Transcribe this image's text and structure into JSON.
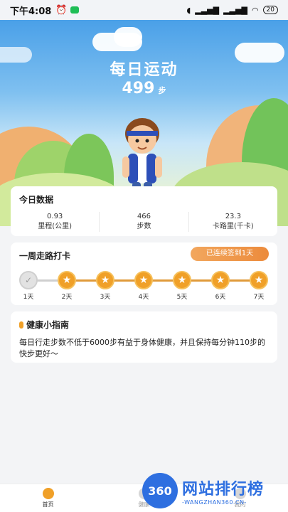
{
  "status_bar": {
    "time": "下午4:08",
    "battery": "20"
  },
  "hero": {
    "title": "每日运动",
    "steps": "499",
    "steps_unit": "步"
  },
  "today": {
    "title": "今日数据",
    "stats": [
      {
        "value": "0.93",
        "label": "里程(公里)"
      },
      {
        "value": "466",
        "label": "步数"
      },
      {
        "value": "23.3",
        "label": "卡路里(千卡)"
      }
    ]
  },
  "checkin": {
    "title": "一周走路打卡",
    "badge": "已连续签到1天",
    "days": [
      "1天",
      "2天",
      "3天",
      "4天",
      "5天",
      "6天",
      "7天"
    ],
    "checked_days": 1
  },
  "guide": {
    "title": "健康小指南",
    "text": "每日行走步数不低于6000步有益于身体健康，并且保持每分钟110步的快步更好～"
  },
  "tabbar": {
    "tabs": [
      {
        "label": "首页"
      },
      {
        "label": "健康"
      },
      {
        "label": "我的"
      }
    ]
  },
  "watermark": {
    "logo": "360",
    "title": "网站排行榜",
    "url": "-WANGZHAN360.CN-"
  },
  "colors": {
    "accent": "#f0a028",
    "badge": "#ec8b3c",
    "sky": "#4aa0e8"
  }
}
